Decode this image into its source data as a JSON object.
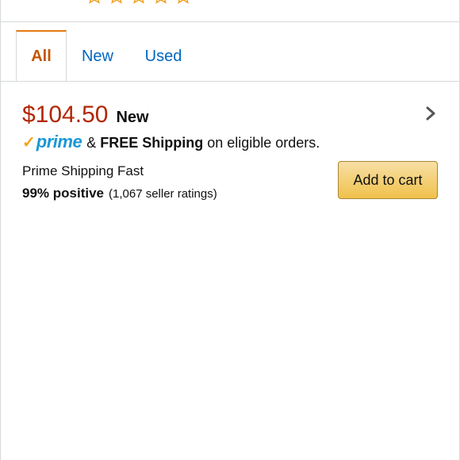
{
  "rating": {
    "stars": 5,
    "star_color": "#f0a021"
  },
  "tabs": [
    {
      "label": "All",
      "active": true
    },
    {
      "label": "New",
      "active": false
    },
    {
      "label": "Used",
      "active": false
    }
  ],
  "offer": {
    "price": "$104.50",
    "condition": "New",
    "prime_label": "prime",
    "shipping_prefix": "&",
    "shipping_bold": "FREE Shipping",
    "shipping_suffix": "on eligible orders.",
    "seller_name": "Prime Shipping Fast",
    "positive": "99% positive",
    "ratings_count": "(1,067 seller ratings)",
    "add_to_cart_label": "Add to cart",
    "chevron_icon": "chevron-right-icon"
  },
  "colors": {
    "price": "#b12704",
    "link": "#0066c0",
    "active_tab": "#c45500",
    "prime_blue": "#1a98d6",
    "prime_check": "#f7a11a",
    "button": "#f0c14b"
  }
}
